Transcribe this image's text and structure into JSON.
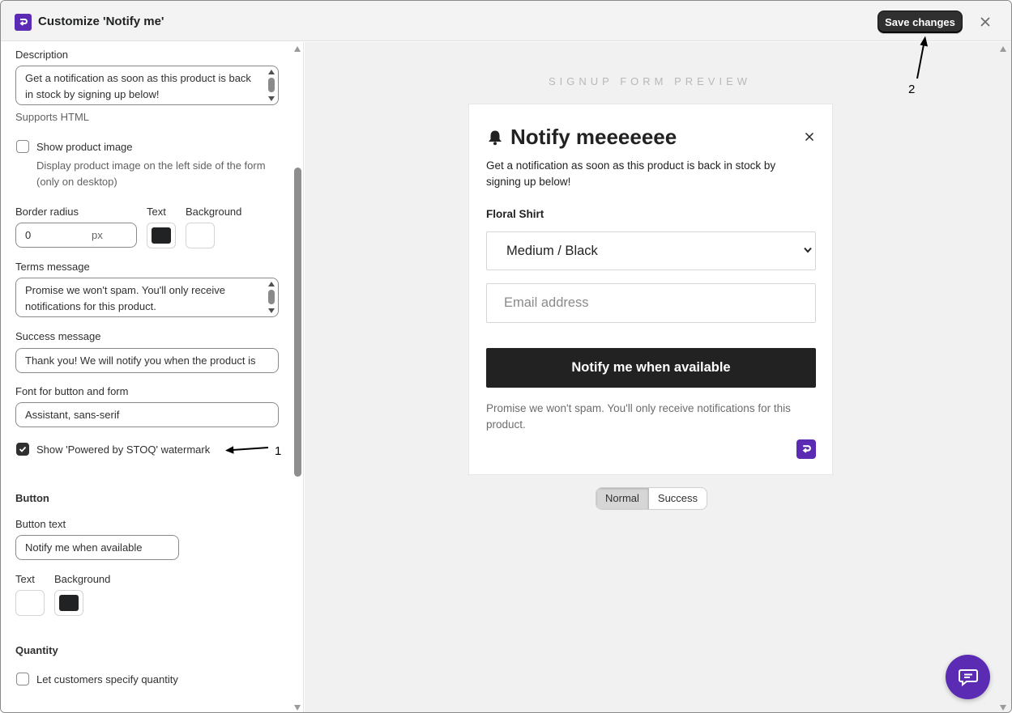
{
  "header": {
    "title": "Customize 'Notify me'",
    "save_label": "Save changes"
  },
  "settings": {
    "description": {
      "label": "Description",
      "value": "Get a notification as soon as this product is back in stock by signing up below!",
      "help": "Supports HTML"
    },
    "show_product_image": {
      "label": "Show product image",
      "help": "Display product image on the left side of the form (only on desktop)",
      "checked": false
    },
    "border_radius": {
      "label": "Border radius",
      "value": "0",
      "suffix": "px"
    },
    "form_colors": {
      "text_label": "Text",
      "text_color": "#202223",
      "background_label": "Background",
      "background_color": "#ffffff"
    },
    "terms": {
      "label": "Terms message",
      "value": "Promise we won't spam. You'll only receive notifications for this product."
    },
    "success": {
      "label": "Success message",
      "value": "Thank you! We will notify you when the product is"
    },
    "font": {
      "label": "Font for button and form",
      "value": "Assistant, sans-serif"
    },
    "watermark": {
      "label": "Show 'Powered by STOQ' watermark",
      "checked": true
    },
    "button": {
      "heading": "Button",
      "text_label": "Button text",
      "text_value": "Notify me when available",
      "text_color_label": "Text",
      "text_color": "#ffffff",
      "background_label": "Background",
      "background_color": "#202223"
    },
    "quantity": {
      "heading": "Quantity",
      "label": "Let customers specify quantity",
      "checked": false
    }
  },
  "annotations": {
    "one": "1",
    "two": "2"
  },
  "preview": {
    "title": "SIGNUP FORM PREVIEW",
    "heading": "Notify meeeeeee",
    "description": "Get a notification as soon as this product is back in stock by signing up below!",
    "product_name": "Floral Shirt",
    "variant": "Medium / Black",
    "email_placeholder": "Email address",
    "button_label": "Notify me when available",
    "terms": "Promise we won't spam. You'll only receive notifications for this product.",
    "modes": [
      "Normal",
      "Success"
    ],
    "active_mode": "Normal"
  },
  "colors": {
    "brand": "#5b2bb3",
    "dark": "#222222"
  },
  "icons": {
    "app": "stoq-logo-icon",
    "close": "close-icon",
    "bell": "bell-icon",
    "chat": "chat-icon"
  }
}
